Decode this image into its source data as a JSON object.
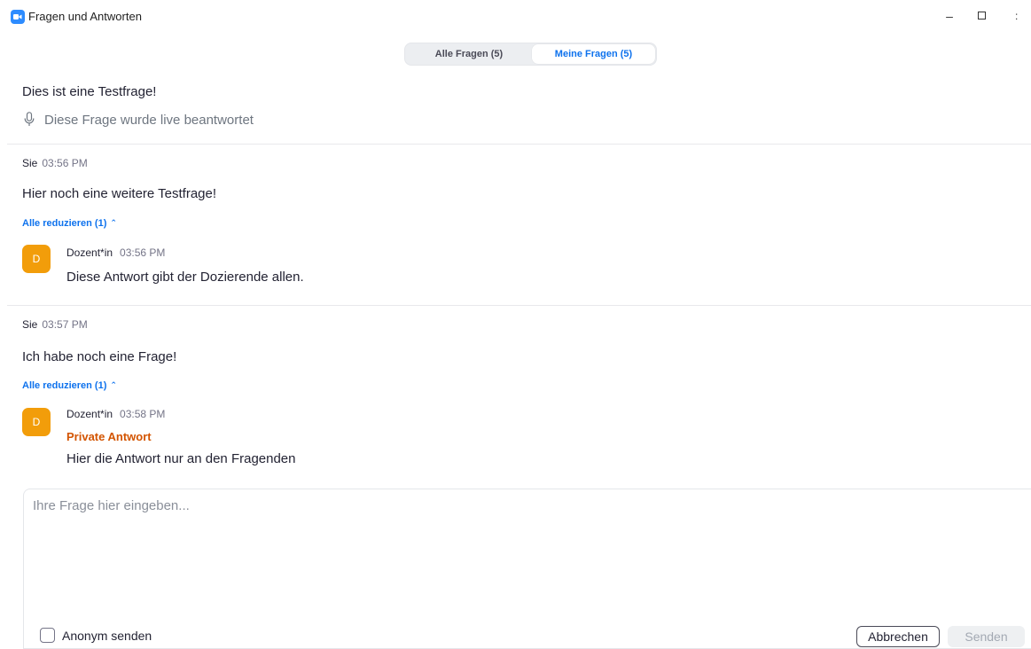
{
  "window": {
    "title": "Fragen und Antworten",
    "app_icon": "zoom-camera-icon",
    "controls": {
      "minimize": "–",
      "close": ":"
    }
  },
  "tabs": {
    "all_label": "Alle Fragen (5)",
    "mine_label": "Meine Fragen (5)",
    "active": "mine"
  },
  "questions": [
    {
      "text": "Dies ist eine Testfrage!",
      "status_icon": "microphone-icon",
      "status": "Diese Frage wurde live beantwortet"
    },
    {
      "author": "Sie",
      "time": "03:56 PM",
      "text": "Hier noch eine weitere Testfrage!",
      "collapse_label": "Alle reduzieren (1)",
      "answer": {
        "avatar_initial": "D",
        "author": "Dozent*in",
        "time": "03:56 PM",
        "text": "Diese Antwort gibt der Dozierende allen."
      }
    },
    {
      "author": "Sie",
      "time": "03:57 PM",
      "text": "Ich habe noch eine Frage!",
      "collapse_label": "Alle reduzieren (1)",
      "answer": {
        "avatar_initial": "D",
        "author": "Dozent*in",
        "time": "03:58 PM",
        "private_label": "Private Antwort",
        "text": "Hier die Antwort nur an den Fragenden"
      }
    }
  ],
  "composer": {
    "placeholder": "Ihre Frage hier eingeben...",
    "value": "",
    "anonymous_label": "Anonym senden",
    "anonymous_checked": false,
    "cancel_label": "Abbrechen",
    "send_label": "Senden"
  },
  "colors": {
    "accent": "#0e72ed",
    "avatar": "#f29d0a",
    "private": "#d35400",
    "muted": "#747487"
  }
}
